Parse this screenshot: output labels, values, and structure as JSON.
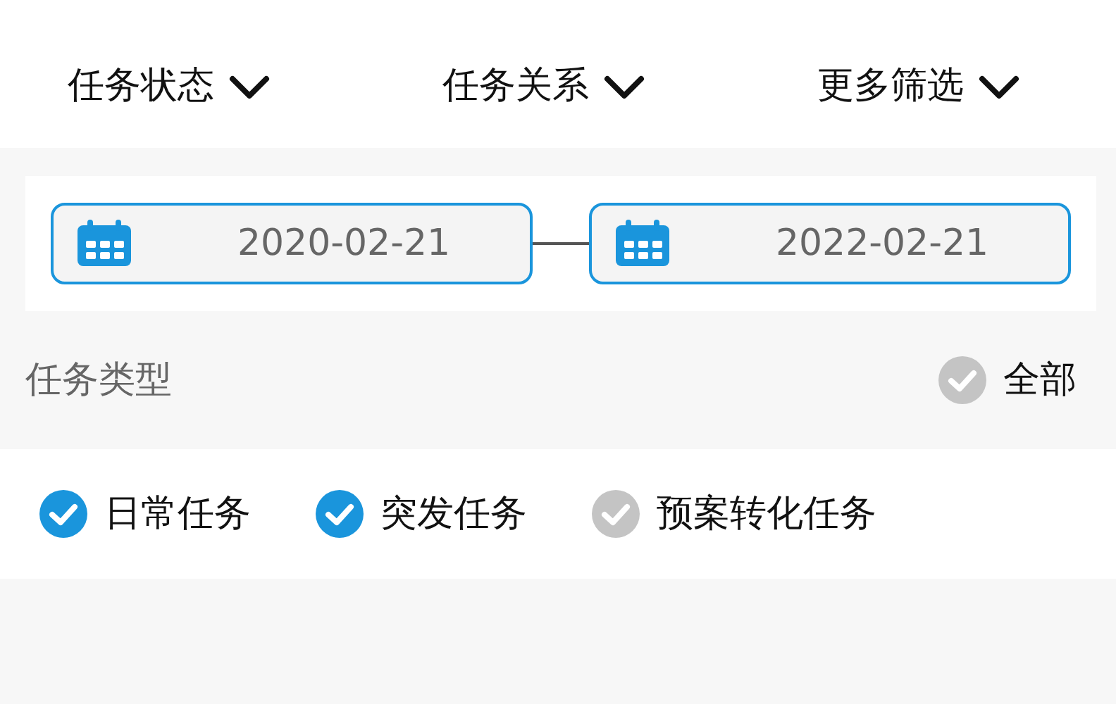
{
  "filters": [
    {
      "label": "任务状态",
      "expanded": false
    },
    {
      "label": "任务关系",
      "expanded": false
    },
    {
      "label": "更多筛选",
      "expanded": false
    }
  ],
  "date_range": {
    "start": "2020-02-21",
    "end": "2022-02-21"
  },
  "task_type": {
    "title": "任务类型",
    "all": {
      "label": "全部",
      "checked": false
    }
  },
  "options": [
    {
      "label": "日常任务",
      "checked": true
    },
    {
      "label": "突发任务",
      "checked": true
    },
    {
      "label": "预案转化任务",
      "checked": false
    }
  ]
}
